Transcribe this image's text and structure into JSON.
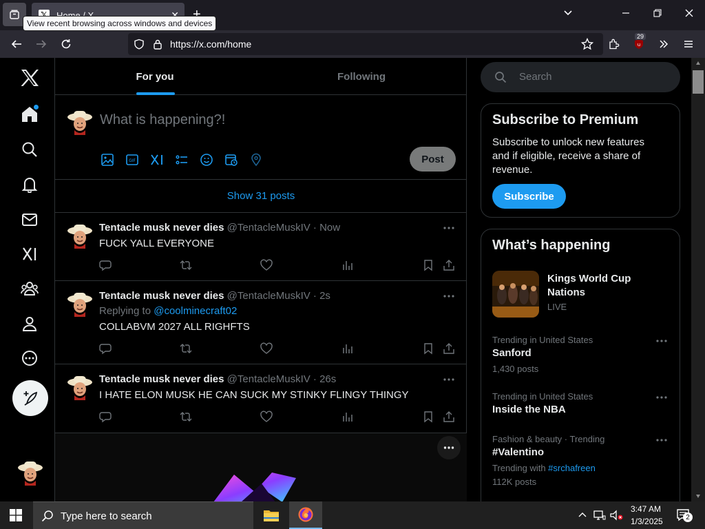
{
  "browser": {
    "tab_title": "Home / X",
    "tab_favicon": "x-logo-icon",
    "tooltip": "View recent browsing across windows and devices",
    "url": "https://x.com/home",
    "extension_badge": "29"
  },
  "leftnav": {
    "items": [
      "x-logo",
      "home",
      "explore",
      "notifications",
      "messages",
      "grok",
      "communities",
      "profile",
      "more"
    ]
  },
  "main": {
    "tabs": [
      "For you",
      "Following"
    ],
    "composer_placeholder": "What is happening?!",
    "post_button": "Post",
    "show_posts": "Show 31 posts",
    "tweets": [
      {
        "name": "Tentacle musk never dies",
        "meta": "@TentacleMuskIV · Now",
        "reply_prefix": "",
        "reply_to": "",
        "text": "FUCK YALL EVERYONE"
      },
      {
        "name": "Tentacle musk never dies",
        "meta": "@TentacleMuskIV · 2s",
        "reply_prefix": "Replying to ",
        "reply_to": "@coolminecraft02",
        "text": "COLLABVM 2027 ALL RIGHFTS"
      },
      {
        "name": "Tentacle musk never dies",
        "meta": "@TentacleMuskIV · 26s",
        "reply_prefix": "",
        "reply_to": "",
        "text": "I HATE ELON MUSK HE CAN SUCK MY STINKY FLINGY THINGY"
      }
    ]
  },
  "right": {
    "search_placeholder": "Search",
    "premium": {
      "title": "Subscribe to Premium",
      "desc": "Subscribe to unlock new features and if eligible, receive a share of revenue.",
      "button": "Subscribe"
    },
    "happening": {
      "title": "What’s happening",
      "event": {
        "title": "Kings World Cup Nations",
        "status": "LIVE"
      },
      "trends": [
        {
          "context": "Trending in United States",
          "name": "Sanford",
          "count": "1,430 posts",
          "with_label": "",
          "with_link": ""
        },
        {
          "context": "Trending in United States",
          "name": "Inside the NBA",
          "count": "",
          "with_label": "",
          "with_link": ""
        },
        {
          "context": "Fashion & beauty · Trending",
          "name": "#Valentino",
          "count": "112K posts",
          "with_label": "Trending with ",
          "with_link": "#srchafreen"
        }
      ]
    }
  },
  "taskbar": {
    "search_placeholder": "Type here to search",
    "time": "3:47 AM",
    "date": "1/3/2025",
    "notification_count": "2"
  },
  "colors": {
    "accent": "#1d9bf0",
    "background": "#000000",
    "border": "#2f3336",
    "muted_text": "#71767b"
  }
}
